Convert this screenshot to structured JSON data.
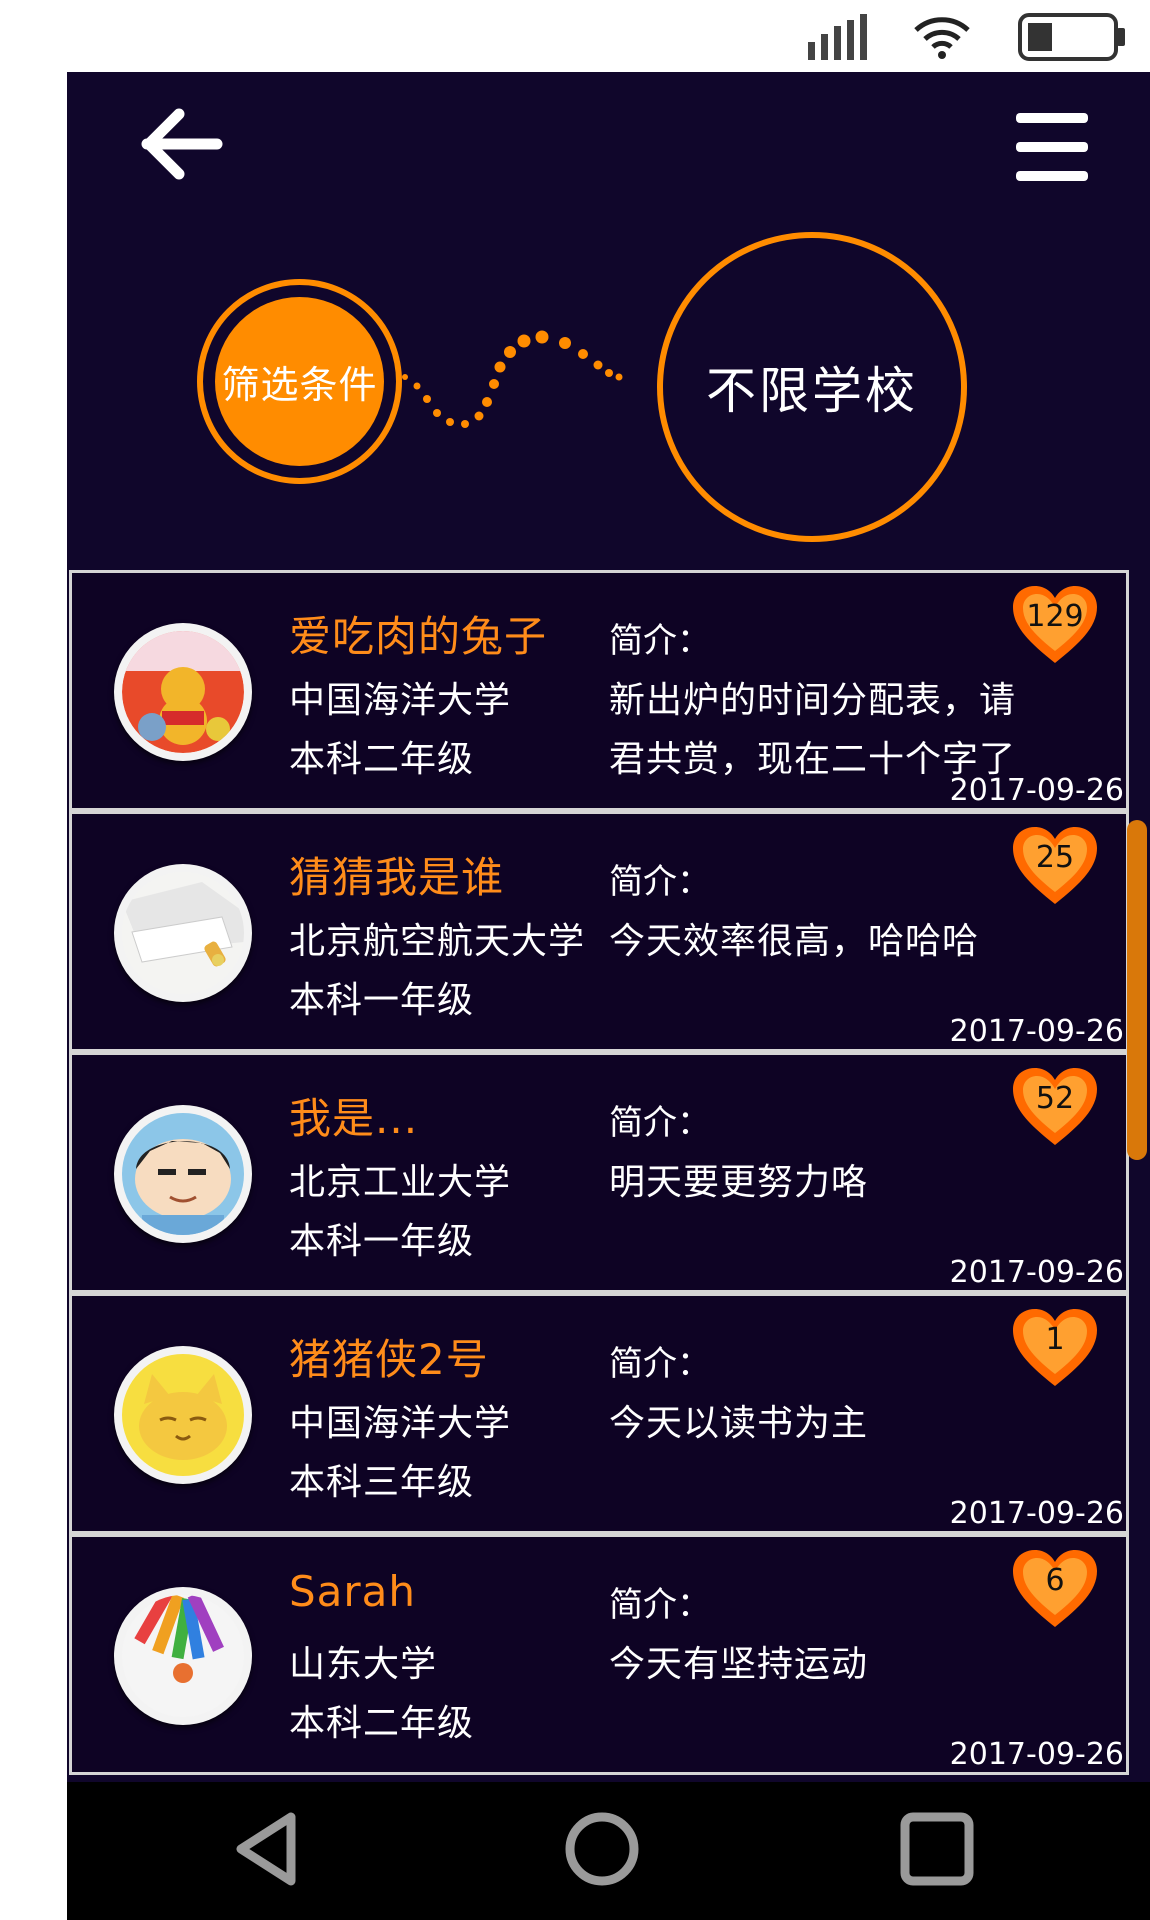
{
  "header": {
    "filter_label": "筛选条件",
    "school_filter_value": "不限学校"
  },
  "colors": {
    "accent": "#ff8c00",
    "background": "#10062b",
    "heart": "#ff6a00"
  },
  "icons": {
    "back": "arrow-left-icon",
    "menu": "hamburger-menu-icon",
    "like": "heart-icon"
  },
  "users": [
    {
      "nickname": "爱吃肉的兔子",
      "school": "中国海洋大学",
      "grade": "本科二年级",
      "intro_label": "简介：",
      "intro": "新出炉的时间分配表，请君共赏，现在二十个字了",
      "likes": "129",
      "date": "2017-09-26"
    },
    {
      "nickname": "猜猜我是谁",
      "school": "北京航空航天大学",
      "grade": "本科一年级",
      "intro_label": "简介：",
      "intro": "今天效率很高，哈哈哈",
      "likes": "25",
      "date": "2017-09-26"
    },
    {
      "nickname": "我是...",
      "school": "北京工业大学",
      "grade": "本科一年级",
      "intro_label": "简介：",
      "intro": "明天要更努力咯",
      "likes": "52",
      "date": "2017-09-26"
    },
    {
      "nickname": "猪猪侠2号",
      "school": "中国海洋大学",
      "grade": "本科三年级",
      "intro_label": "简介：",
      "intro": "今天以读书为主",
      "likes": "1",
      "date": "2017-09-26"
    },
    {
      "nickname": "Sarah",
      "school": "山东大学",
      "grade": "本科二年级",
      "intro_label": "简介：",
      "intro": "今天有坚持运动",
      "likes": "6",
      "date": "2017-09-26"
    }
  ]
}
